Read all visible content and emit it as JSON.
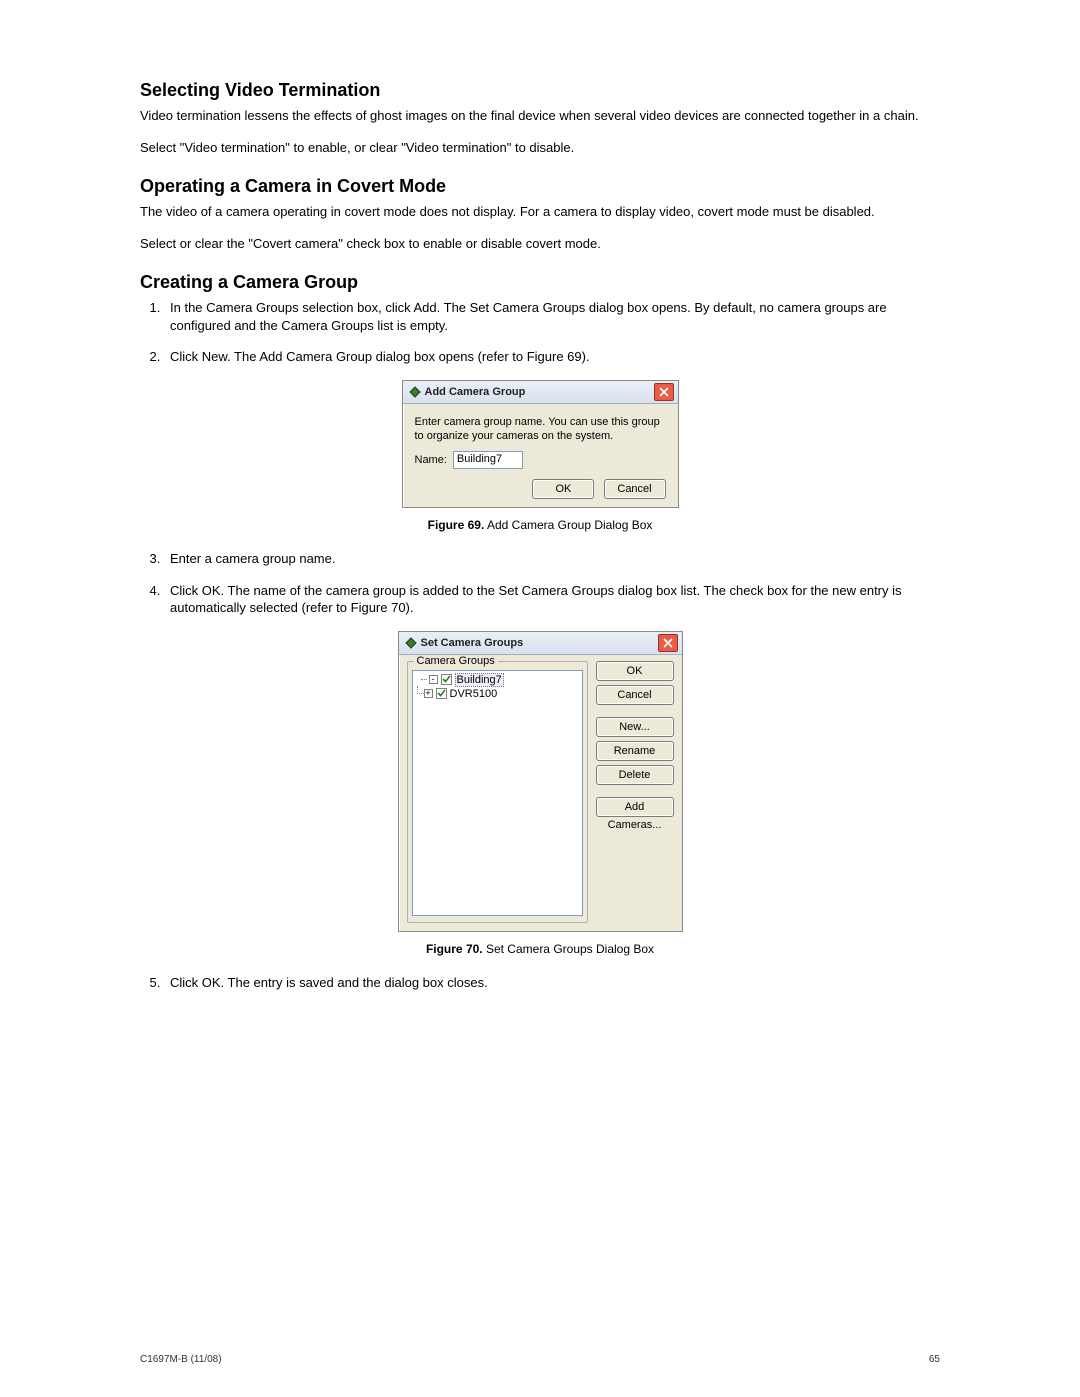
{
  "section1": {
    "title": "Selecting Video Termination",
    "p1": "Video termination lessens the effects of ghost images on the final device when several video devices are connected together in a chain.",
    "p2": "Select \"Video termination\" to enable, or clear \"Video termination\" to disable."
  },
  "section2": {
    "title": "Operating a Camera in Covert Mode",
    "p1": "The video of a camera operating in covert mode does not display. For a camera to display video, covert mode must be disabled.",
    "p2": "Select or clear the \"Covert camera\" check box to enable or disable covert mode."
  },
  "section3": {
    "title": "Creating a Camera Group",
    "steps": {
      "s1": "In the Camera Groups selection box, click Add. The Set Camera Groups dialog box opens. By default, no camera groups are configured and the Camera Groups list is empty.",
      "s2": "Click New. The Add Camera Group dialog box opens (refer to Figure 69).",
      "s3": "Enter a camera group name.",
      "s4": "Click OK. The name of the camera group is added to the Set Camera Groups dialog box list. The check box for the new entry is automatically selected (refer to Figure 70).",
      "s5": "Click OK. The entry is saved and the dialog box closes."
    }
  },
  "figure69": {
    "label_bold": "Figure 69.",
    "label_rest": "  Add Camera Group Dialog Box",
    "dialog_title": "Add Camera Group",
    "instruction": "Enter camera group name. You can use this group to organize your cameras on the system.",
    "name_label": "Name:",
    "name_value": "Building7",
    "ok": "OK",
    "cancel": "Cancel"
  },
  "figure70": {
    "label_bold": "Figure 70.",
    "label_rest": "  Set Camera Groups Dialog Box",
    "dialog_title": "Set Camera Groups",
    "groupbox_label": "Camera Groups",
    "items": [
      {
        "expander": "-",
        "checked": true,
        "label": "Building7",
        "selected": true
      },
      {
        "expander": "+",
        "checked": true,
        "label": "DVR5100",
        "selected": false
      }
    ],
    "buttons": {
      "ok": "OK",
      "cancel": "Cancel",
      "new": "New...",
      "rename": "Rename",
      "delete": "Delete",
      "add_cameras": "Add Cameras..."
    }
  },
  "footer": {
    "left": "C1697M-B (11/08)",
    "right": "65"
  }
}
